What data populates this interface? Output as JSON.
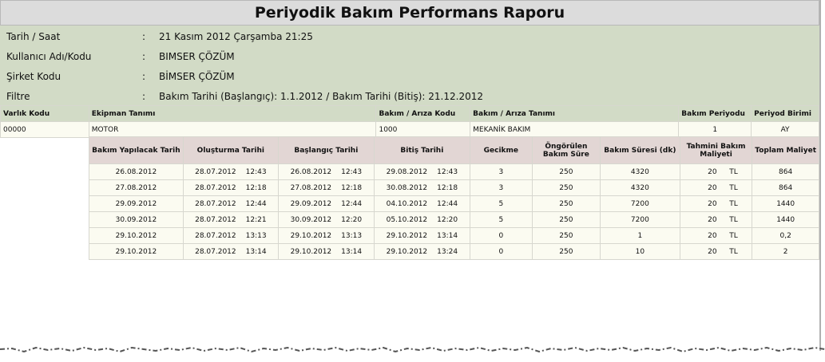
{
  "title": "Periyodik Bakım Performans Raporu",
  "info": [
    {
      "label": "Tarih / Saat",
      "sep": ":",
      "value": "21 Kasım 2012 Çarşamba 21:25"
    },
    {
      "label": "Kullanıcı Adı/Kodu",
      "sep": ":",
      "value": "BIMSER ÇÖZÜM"
    },
    {
      "label": "Şirket Kodu",
      "sep": ":",
      "value": "BİMSER ÇÖZÜM"
    },
    {
      "label": "Filtre",
      "sep": ":",
      "value": "Bakım Tarihi (Başlangıç): 1.1.2012 / Bakım Tarihi (Bitiş): 21.12.2012"
    }
  ],
  "main": {
    "headers": [
      "Varlık Kodu",
      "Ekipman Tanımı",
      "Bakım / Arıza Kodu",
      "Bakım / Arıza Tanımı",
      "Bakım Periyodu",
      "Periyod Birimi"
    ],
    "row": [
      "00000",
      "MOTOR",
      "1000",
      "MEKANİK BAKIM",
      "1",
      "AY"
    ]
  },
  "detail": {
    "headers": [
      "Bakım Yapılacak Tarih",
      "Oluşturma Tarihi",
      "Başlangıç Tarihi",
      "Bitiş Tarihi",
      "Gecikme",
      "Öngörülen Bakım Süre",
      "Bakım Süresi (dk)",
      "Tahmini Bakım Maliyeti",
      "Toplam Maliyet"
    ],
    "rows": [
      {
        "due": "26.08.2012",
        "created": [
          "28.07.2012",
          "12:43"
        ],
        "start": [
          "26.08.2012",
          "12:43"
        ],
        "end": [
          "29.08.2012",
          "12:43"
        ],
        "delay": "3",
        "planned": "250",
        "duration": "4320",
        "cost": "20",
        "currency": "TL",
        "total": "864"
      },
      {
        "due": "27.08.2012",
        "created": [
          "28.07.2012",
          "12:18"
        ],
        "start": [
          "27.08.2012",
          "12:18"
        ],
        "end": [
          "30.08.2012",
          "12:18"
        ],
        "delay": "3",
        "planned": "250",
        "duration": "4320",
        "cost": "20",
        "currency": "TL",
        "total": "864"
      },
      {
        "due": "29.09.2012",
        "created": [
          "28.07.2012",
          "12:44"
        ],
        "start": [
          "29.09.2012",
          "12:44"
        ],
        "end": [
          "04.10.2012",
          "12:44"
        ],
        "delay": "5",
        "planned": "250",
        "duration": "7200",
        "cost": "20",
        "currency": "TL",
        "total": "1440"
      },
      {
        "due": "30.09.2012",
        "created": [
          "28.07.2012",
          "12:21"
        ],
        "start": [
          "30.09.2012",
          "12:20"
        ],
        "end": [
          "05.10.2012",
          "12:20"
        ],
        "delay": "5",
        "planned": "250",
        "duration": "7200",
        "cost": "20",
        "currency": "TL",
        "total": "1440"
      },
      {
        "due": "29.10.2012",
        "created": [
          "28.07.2012",
          "13:13"
        ],
        "start": [
          "29.10.2012",
          "13:13"
        ],
        "end": [
          "29.10.2012",
          "13:14"
        ],
        "delay": "0",
        "planned": "250",
        "duration": "1",
        "cost": "20",
        "currency": "TL",
        "total": "0,2"
      },
      {
        "due": "29.10.2012",
        "created": [
          "28.07.2012",
          "13:14"
        ],
        "start": [
          "29.10.2012",
          "13:14"
        ],
        "end": [
          "29.10.2012",
          "13:24"
        ],
        "delay": "0",
        "planned": "250",
        "duration": "10",
        "cost": "20",
        "currency": "TL",
        "total": "2"
      }
    ]
  }
}
